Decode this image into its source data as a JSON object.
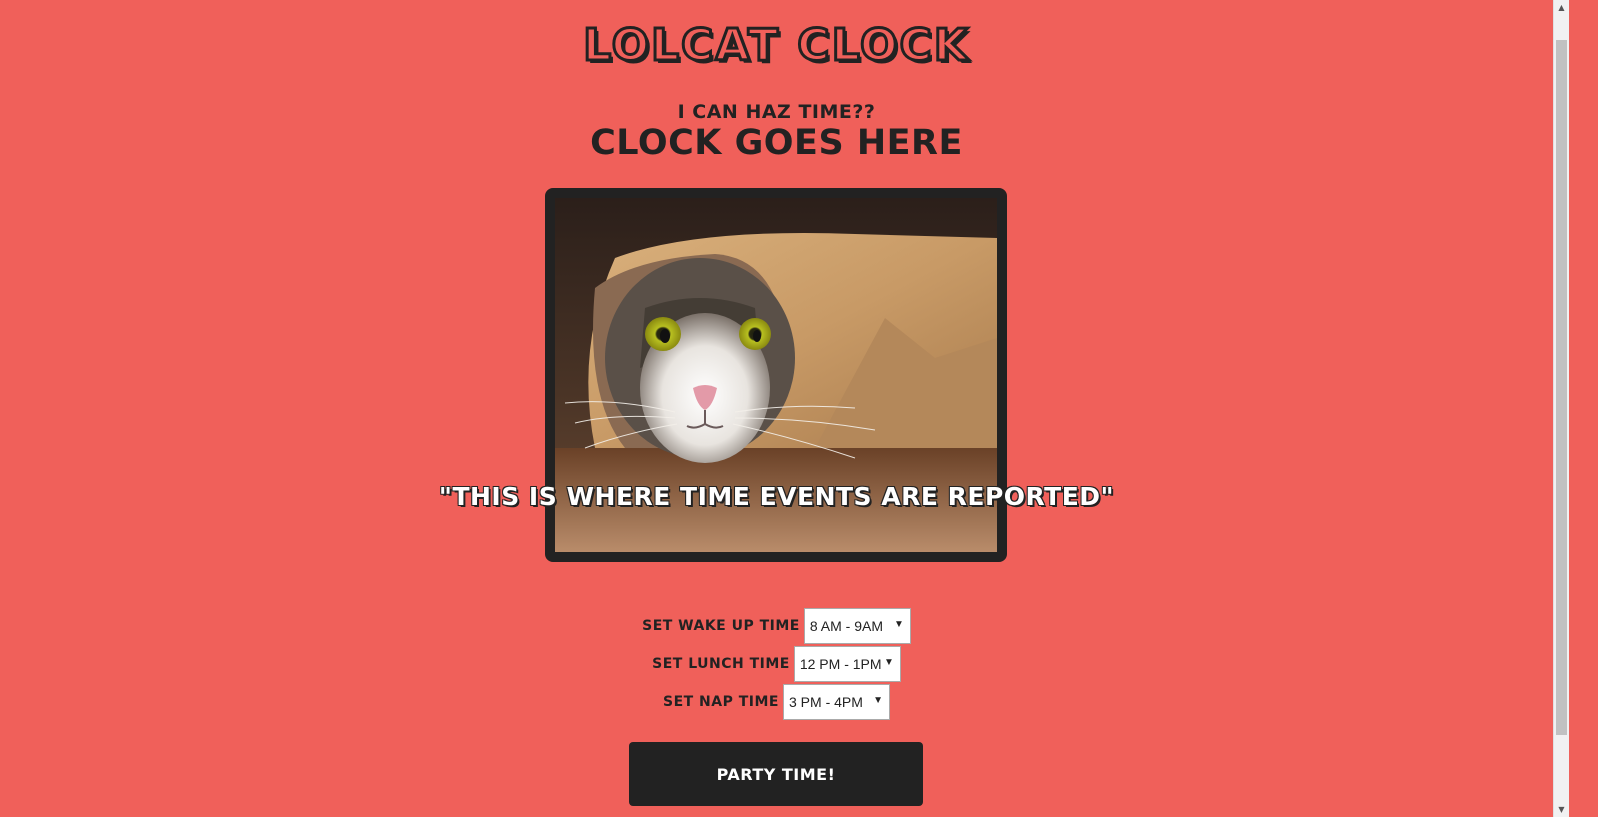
{
  "page": {
    "title": "Lolcat Clock",
    "subtitle": "I can haz time??",
    "clock": "Clock goes here",
    "caption": "\"THIS IS WHERE TIME EVENTS ARE REPORTED\"",
    "image_description_icon": "lolcat-image"
  },
  "settings": {
    "wake": {
      "label": "Set wake up time",
      "value": "8 AM - 9AM"
    },
    "lunch": {
      "label": "Set lunch time",
      "value": "12 PM - 1PM"
    },
    "nap": {
      "label": "Set nap time",
      "value": "3 PM - 4PM"
    }
  },
  "button": {
    "label": "PARTY TIME!"
  },
  "colors": {
    "background": "#f0605a",
    "dark": "#222222",
    "text_light": "#ffffff"
  },
  "icons": {
    "dropdown": "chevron-down-icon",
    "scroll_up": "scroll-up-icon",
    "scroll_down": "scroll-down-icon"
  }
}
